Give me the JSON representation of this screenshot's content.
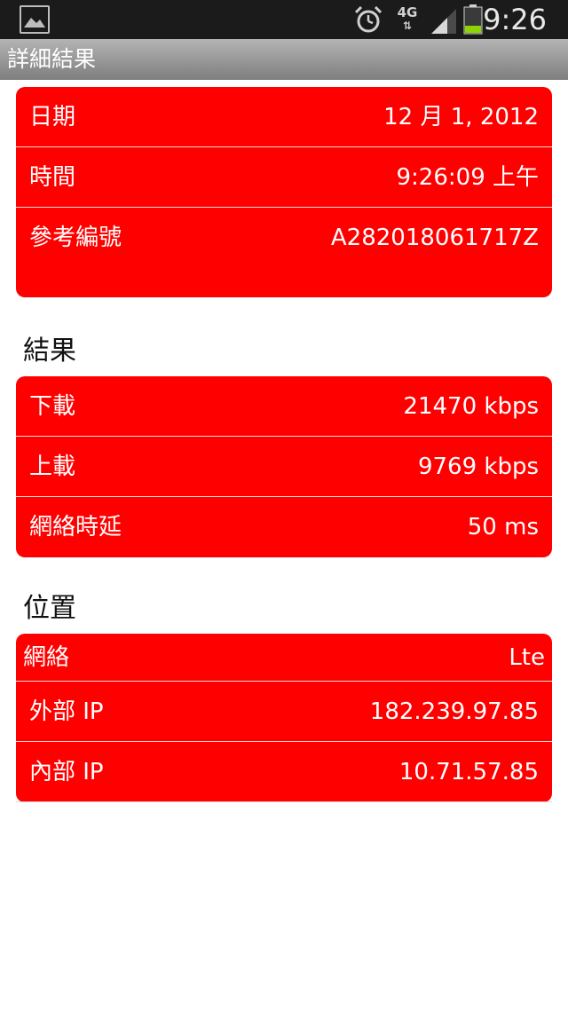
{
  "status_bar": {
    "time": "9:26",
    "network": "4G",
    "network_arrows": "⇅",
    "icons": [
      "gallery-icon",
      "alarm-icon",
      "signal-icon",
      "battery-icon"
    ]
  },
  "title_bar": {
    "title": "詳細結果"
  },
  "details": [
    {
      "label": "日期",
      "value": "12 月 1, 2012"
    },
    {
      "label": "時間",
      "value": "9:26:09 上午"
    },
    {
      "label": "參考編號",
      "value": "A282018061717Z"
    }
  ],
  "results": {
    "heading": "結果",
    "rows": [
      {
        "label": "下載",
        "value": "21470 kbps"
      },
      {
        "label": "上載",
        "value": "9769 kbps"
      },
      {
        "label": "網絡時延",
        "value": "50 ms"
      }
    ]
  },
  "location": {
    "heading": "位置",
    "rows": [
      {
        "label": "網絡",
        "value": "Lte"
      },
      {
        "label": "外部 IP",
        "value": "182.239.97.85"
      },
      {
        "label": "內部 IP",
        "value": "10.71.57.85"
      }
    ]
  },
  "colors": {
    "card": "#ff0000",
    "status_bar": "#1b1b1b",
    "battery_level": "#8ed400"
  }
}
